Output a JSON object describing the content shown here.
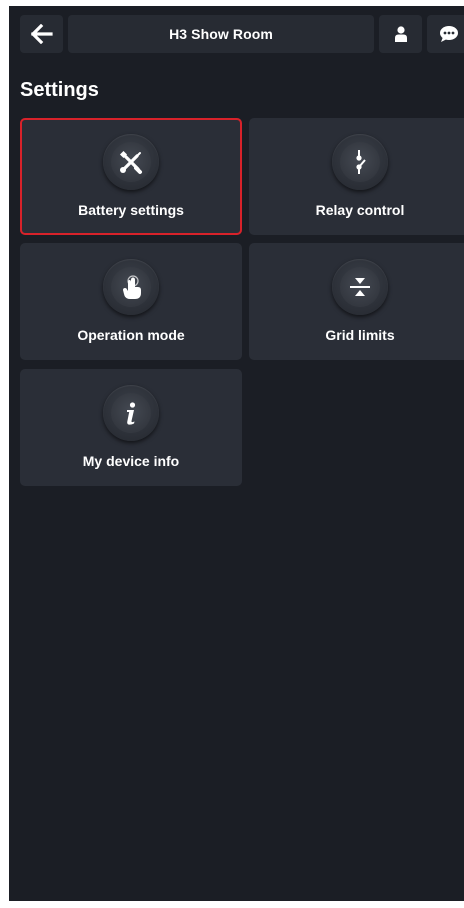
{
  "header": {
    "back_icon": "arrow-left-icon",
    "title": "H3 Show Room",
    "user_icon": "user-icon",
    "chat_icon": "chat-bubble-icon"
  },
  "page": {
    "title": "Settings"
  },
  "tiles": [
    {
      "label": "Battery settings",
      "icon": "wrench-screwdriver-icon",
      "selected": true
    },
    {
      "label": "Relay control",
      "icon": "relay-switch-icon",
      "selected": false
    },
    {
      "label": "Operation mode",
      "icon": "hand-touch-icon",
      "selected": false
    },
    {
      "label": "Grid limits",
      "icon": "grid-limits-icon",
      "selected": false
    },
    {
      "label": "My device info",
      "icon": "info-icon",
      "selected": false
    }
  ],
  "colors": {
    "background": "#1b1e25",
    "tile": "#2a2e37",
    "selection_outline": "#d8222a",
    "text": "#ffffff"
  }
}
